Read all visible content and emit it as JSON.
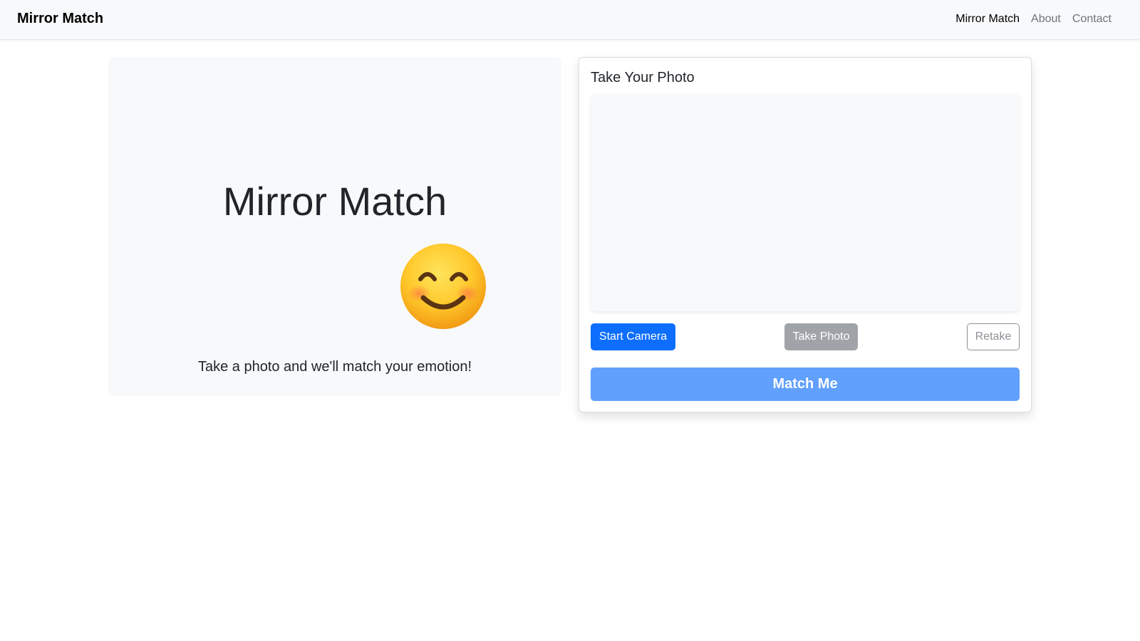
{
  "navbar": {
    "brand": "Mirror Match",
    "links": [
      {
        "label": "Mirror Match",
        "active": true
      },
      {
        "label": "About",
        "active": false
      },
      {
        "label": "Contact",
        "active": false
      }
    ]
  },
  "hero": {
    "title": "Mirror Match",
    "emoji_icon": "smiling-face-icon",
    "tagline": "Take a photo and we'll match your emotion!"
  },
  "photo_card": {
    "title": "Take Your Photo",
    "buttons": {
      "start_camera": "Start Camera",
      "take_photo": "Take Photo",
      "retake": "Retake"
    },
    "match_button": "Match Me"
  },
  "colors": {
    "primary": "#0d6efd",
    "primary_disabled": "#61a0fc",
    "secondary_disabled": "#a0a4a8",
    "panel_bg": "#f8f9fa"
  }
}
